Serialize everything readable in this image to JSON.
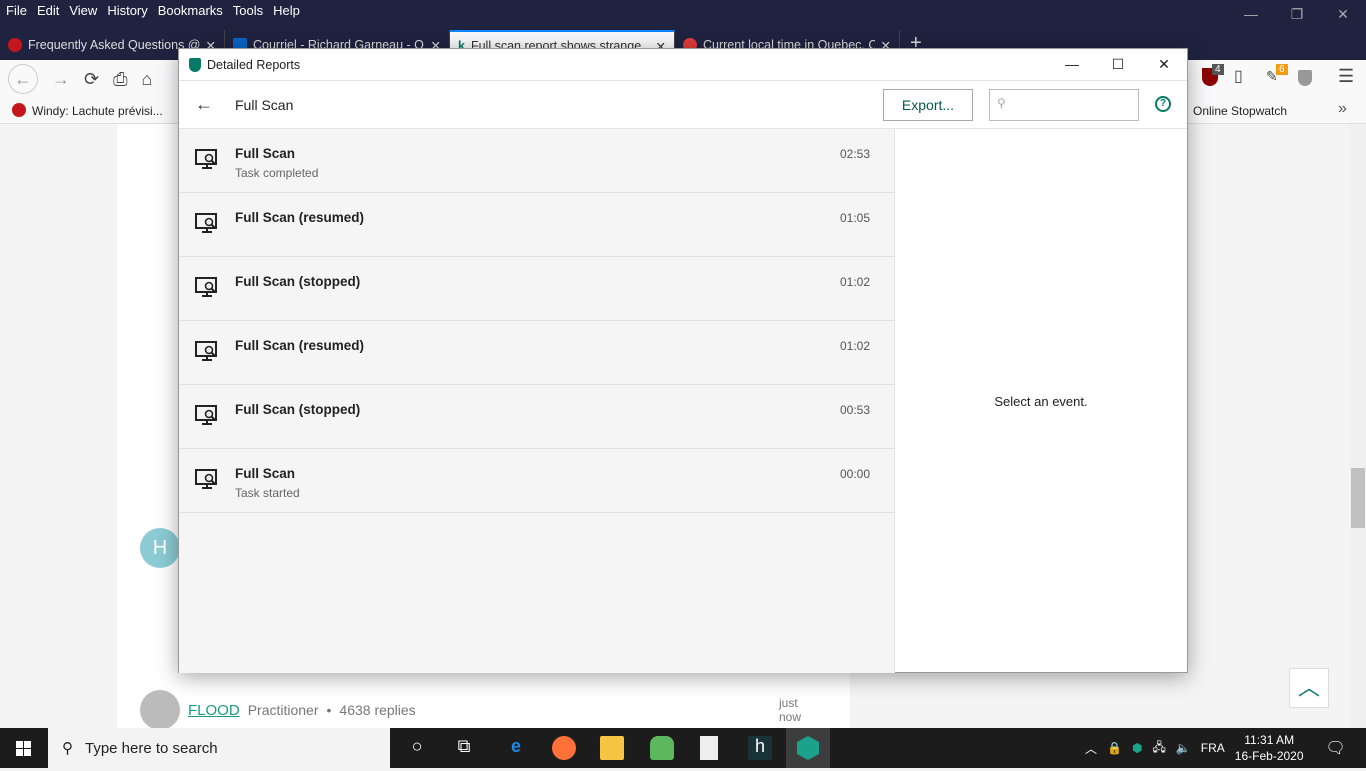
{
  "browser": {
    "menu": [
      "File",
      "Edit",
      "View",
      "History",
      "Bookmarks",
      "Tools",
      "Help"
    ],
    "tabs": [
      {
        "title": "Frequently Asked Questions @",
        "color": "#c4161c"
      },
      {
        "title": "Courriel - Richard Garneau - O",
        "color": "#0a64c8"
      },
      {
        "title": "Full scan report shows strange",
        "color": "#067a64",
        "active": true
      },
      {
        "title": "Current local time in Quebec, C",
        "color": "#e03a3a"
      }
    ],
    "bookmarks": {
      "left": "Windy: Lachute prévisi...",
      "right": "Online Stopwatch"
    },
    "badges": {
      "ublock": "4",
      "ext": "6"
    }
  },
  "dialog": {
    "title": "Detailed Reports",
    "header_title": "Full Scan",
    "export_label": "Export...",
    "search_placeholder": "",
    "help": "?",
    "events": [
      {
        "title": "Full Scan",
        "subtitle": "Task completed",
        "time": "02:53"
      },
      {
        "title": "Full Scan (resumed)",
        "subtitle": "",
        "time": "01:05"
      },
      {
        "title": "Full Scan (stopped)",
        "subtitle": "",
        "time": "01:02"
      },
      {
        "title": "Full Scan (resumed)",
        "subtitle": "",
        "time": "01:02"
      },
      {
        "title": "Full Scan (stopped)",
        "subtitle": "",
        "time": "00:53"
      },
      {
        "title": "Full Scan",
        "subtitle": "Task started",
        "time": "00:00"
      }
    ],
    "empty_detail": "Select an event."
  },
  "page": {
    "avatar_letter": "H",
    "post": {
      "user": "FLOOD",
      "rank": "Practitioner",
      "replies": "4638 replies",
      "time": "just now"
    }
  },
  "taskbar": {
    "search_placeholder": "Type here to search",
    "lang": "FRA",
    "time": "11:31 AM",
    "date": "16-Feb-2020"
  }
}
